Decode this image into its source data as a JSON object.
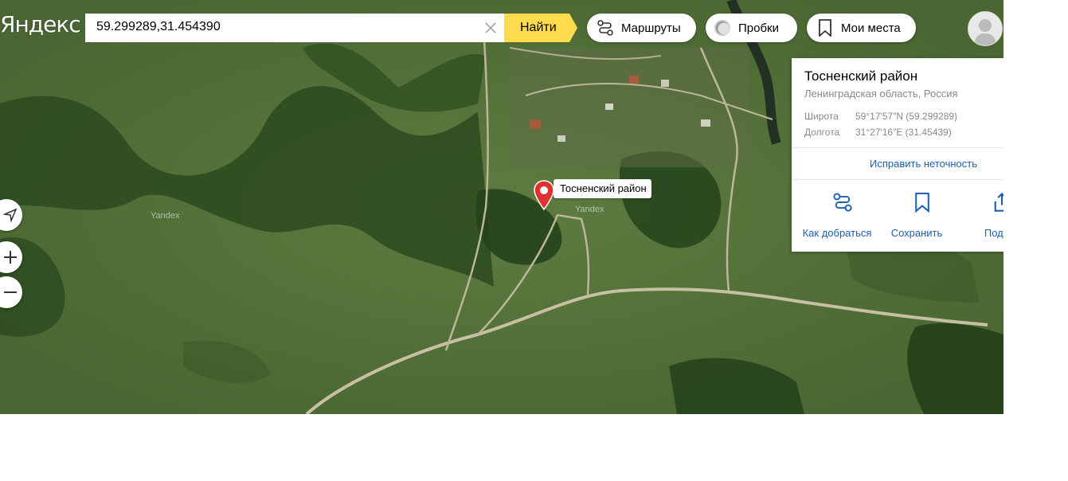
{
  "header": {
    "logo": "Яндекс",
    "search": {
      "value": "59.299289,31.454390",
      "find_label": "Найти"
    },
    "routes_label": "Маршруты",
    "traffic_label": "Пробки",
    "places_label": "Мои места"
  },
  "map": {
    "watermarks": [
      "Yandex",
      "Yandex"
    ],
    "marker_label": "Тосненский район",
    "controls": [
      "locate-icon",
      "zoom-in-icon",
      "zoom-out-icon"
    ]
  },
  "panel": {
    "title": "Тосненский район",
    "subtitle": "Ленинградская область, Россия",
    "lat_label": "Широта",
    "lat_value": "59°17′57″N (59.299289)",
    "lon_label": "Долгота",
    "lon_value": "31°27′16″E (31.45439)",
    "fix_label": "Исправить неточность",
    "actions": [
      {
        "label": "Как добраться",
        "icon": "route-icon"
      },
      {
        "label": "Сохранить",
        "icon": "bookmark-icon"
      },
      {
        "label": "Подел",
        "icon": "share-icon"
      }
    ]
  },
  "colors": {
    "accent_yellow": "#ffdb4d",
    "link_blue": "#1a5fb4",
    "marker_red": "#e03030"
  }
}
